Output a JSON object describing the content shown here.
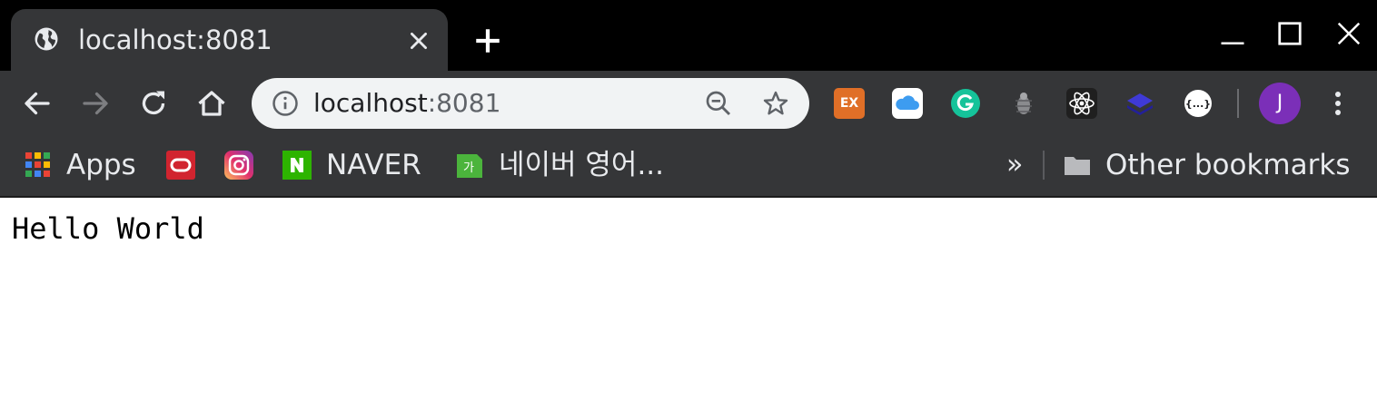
{
  "tab": {
    "title": "localhost:8081",
    "favicon": "globe-icon"
  },
  "toolbar": {
    "url_host": "localhost",
    "url_port": ":8081",
    "extensions": [
      "ex-extension-icon",
      "icloud-extension-icon",
      "grammarly-extension-icon",
      "bug-extension-icon",
      "react-devtools-icon",
      "layers-extension-icon",
      "json-viewer-icon"
    ],
    "profile_initial": "J",
    "profile_color": "#7b2fb8"
  },
  "bookmarks": {
    "apps_label": "Apps",
    "naver_label": "NAVER",
    "naver_dict_label": "네이버 영어...",
    "more_label": "»",
    "other_label": "Other bookmarks"
  },
  "page": {
    "text": "Hello World"
  },
  "colors": {
    "tabstrip": "#000000",
    "toolbar": "#353638",
    "omnibox": "#f1f3f4",
    "text_light": "#e8eaed"
  }
}
